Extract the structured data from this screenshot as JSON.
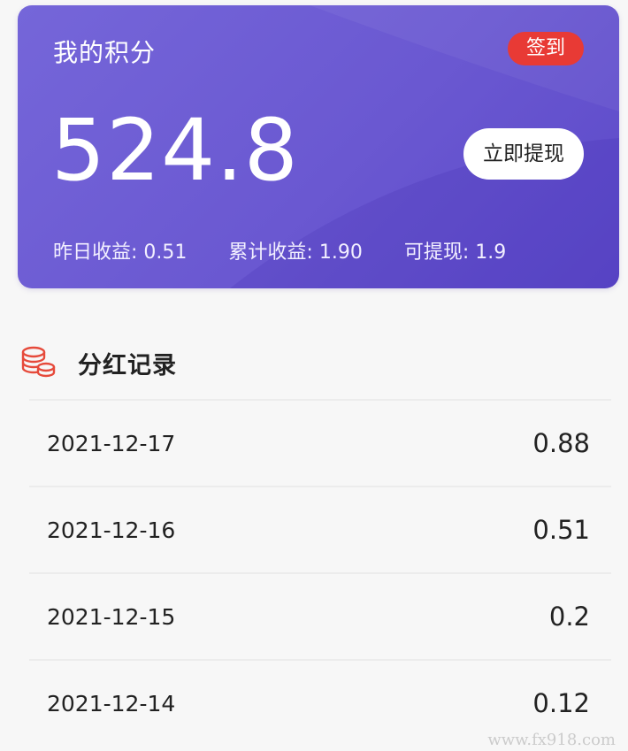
{
  "card": {
    "title": "我的积分",
    "signin_label": "签到",
    "points": "524.8",
    "withdraw_label": "立即提现",
    "stats": [
      {
        "label": "昨日收益:",
        "value": "0.51"
      },
      {
        "label": "累计收益:",
        "value": "1.90"
      },
      {
        "label": "可提现:",
        "value": "1.9"
      }
    ],
    "gradient_start": "#7566d9",
    "gradient_end": "#5c49c9",
    "signin_color": "#e83a35"
  },
  "section": {
    "icon": "coin-stack-icon",
    "title": "分红记录",
    "icon_color": "#e64a3b"
  },
  "records": [
    {
      "date": "2021-12-17",
      "value": "0.88"
    },
    {
      "date": "2021-12-16",
      "value": "0.51"
    },
    {
      "date": "2021-12-15",
      "value": "0.2"
    },
    {
      "date": "2021-12-14",
      "value": "0.12"
    }
  ],
  "watermark": "www.fx918.com"
}
